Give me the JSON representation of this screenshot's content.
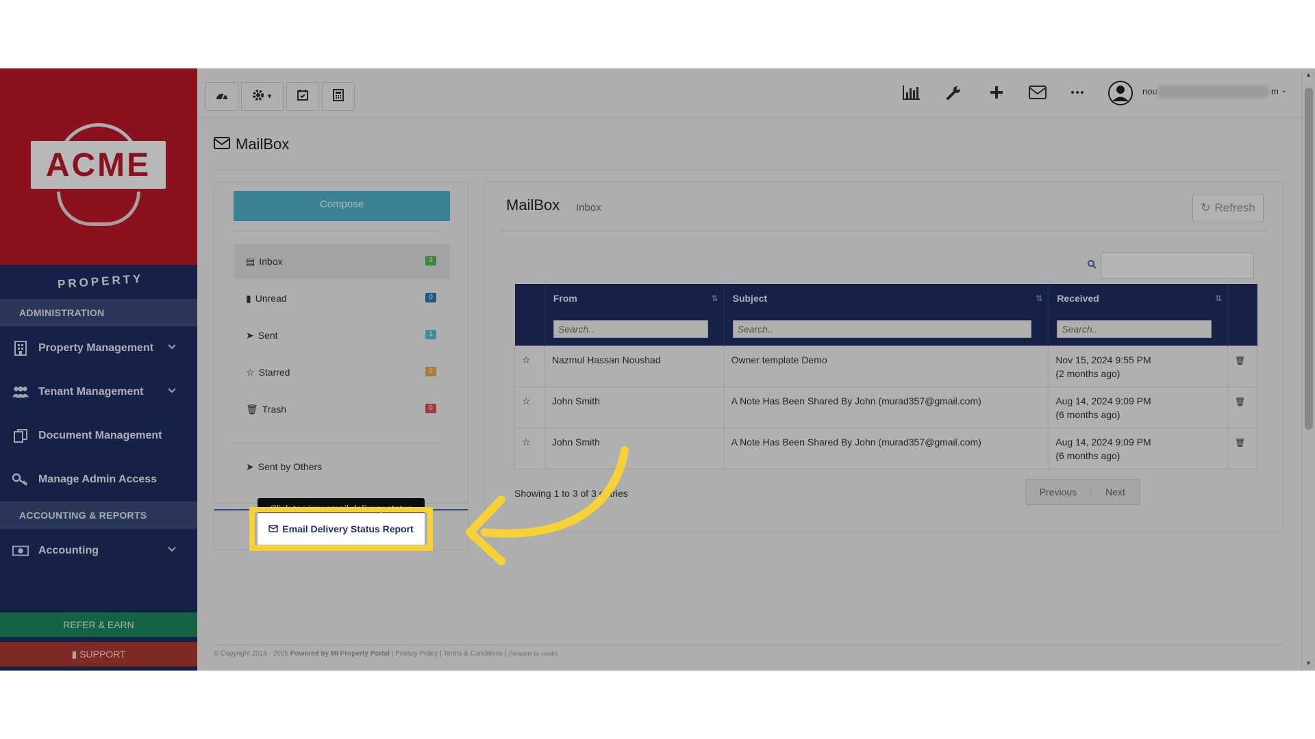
{
  "brand": {
    "logo_text": "ACME",
    "logo_subtext": "PROPERTY"
  },
  "sidebar": {
    "sections": [
      {
        "title": "ADMINISTRATION"
      },
      {
        "title": "ACCOUNTING & REPORTS"
      }
    ],
    "items": [
      {
        "label": "Property Management",
        "icon": "building-icon",
        "has_submenu": true
      },
      {
        "label": "Tenant Management",
        "icon": "users-icon",
        "has_submenu": true
      },
      {
        "label": "Document Management",
        "icon": "documents-icon",
        "has_submenu": false
      },
      {
        "label": "Manage Admin Access",
        "icon": "key-icon",
        "has_submenu": false
      },
      {
        "label": "Accounting",
        "icon": "money-icon",
        "has_submenu": true
      }
    ],
    "refer_label": "REFER & EARN",
    "support_label": "SUPPORT"
  },
  "topbar": {
    "user_name_visible": "nou",
    "user_name_tail": "m",
    "icons": [
      "dashboard-icon",
      "gear-icon",
      "calendar-check-icon",
      "calculator-icon",
      "bar-chart-icon",
      "wrench-icon",
      "plus-icon",
      "envelope-icon",
      "more-icon",
      "avatar"
    ]
  },
  "page": {
    "title": "MailBox"
  },
  "mail_nav": {
    "compose_label": "Compose",
    "folders": [
      {
        "label": "Inbox",
        "count": "3",
        "color": "#5cb85c",
        "icon": "inbox-icon"
      },
      {
        "label": "Unread",
        "count": "0",
        "color": "#337ab7",
        "icon": "book-icon"
      },
      {
        "label": "Sent",
        "count": "1",
        "color": "#5bc0de",
        "icon": "send-icon"
      },
      {
        "label": "Starred",
        "count": "0",
        "color": "#f0ad4e",
        "icon": "star-icon"
      },
      {
        "label": "Trash",
        "count": "0",
        "color": "#d9534f",
        "icon": "trash-icon"
      }
    ],
    "sent_by_others_label": "Sent by Others"
  },
  "mailbox": {
    "title": "MailBox",
    "subtitle": "Inbox",
    "refresh_label": "Refresh",
    "columns": [
      "From",
      "Subject",
      "Received"
    ],
    "search_placeholder": "Search..",
    "rows": [
      {
        "from": "Nazmul Hassan Noushad",
        "subject": "Owner template Demo",
        "received": "Nov 15, 2024 9:55 PM",
        "relative": "(2 months ago)"
      },
      {
        "from": "John Smith",
        "subject": "A Note Has Been Shared By John (murad357@gmail.com)",
        "received": "Aug 14, 2024 9:09 PM",
        "relative": "(6 months ago)"
      },
      {
        "from": "John Smith",
        "subject": "A Note Has Been Shared By John (murad357@gmail.com)",
        "received": "Aug 14, 2024 9:09 PM",
        "relative": "(6 months ago)"
      }
    ],
    "showing_text": "Showing 1 to 3 of 3 entries",
    "previous_label": "Previous",
    "next_label": "Next"
  },
  "report": {
    "tooltip": "Click to view email delivery status",
    "link_label": "Email Delivery Status Report"
  },
  "footer": {
    "copyright": "© Copyright 2016 - 2025",
    "powered": "Powered by MI Property Portal",
    "links": "| Privacy Policy | Terms & Conditions |",
    "note": "(Template by cswiki)"
  },
  "colors": {
    "brand_red": "#c0182a",
    "navy": "#1e2f63",
    "accent_yellow": "#f7d237",
    "compose_blue": "#4fb6cf"
  }
}
